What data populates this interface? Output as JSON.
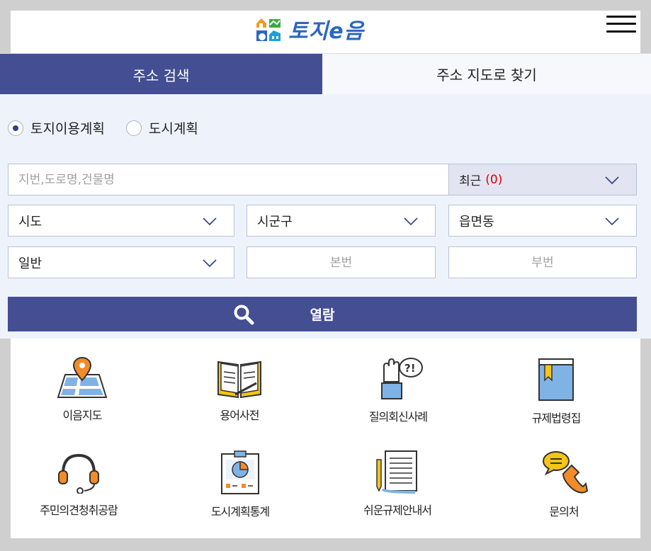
{
  "header": {
    "logo_text": "토지e음",
    "menu_icon": "hamburger-menu-icon"
  },
  "tabs": [
    {
      "label": "주소 검색",
      "active": true
    },
    {
      "label": "주소 지도로 찾기",
      "active": false
    }
  ],
  "plan_type": {
    "options": [
      {
        "label": "토지이용계획",
        "selected": true
      },
      {
        "label": "도시계획",
        "selected": false
      }
    ]
  },
  "search": {
    "placeholder": "지번,도로명,건물명",
    "value": "",
    "recent_label": "최근",
    "recent_count": "(0)"
  },
  "selects": {
    "sido": "시도",
    "sigungu": "시군구",
    "eupmyeondong": "읍면동",
    "land_type": "일반"
  },
  "lot_number": {
    "main_placeholder": "본번",
    "sub_placeholder": "부번"
  },
  "view_button": {
    "label": "열람",
    "icon": "search-icon"
  },
  "quick_menu": [
    {
      "label": "이음지도",
      "icon": "map-pin-icon"
    },
    {
      "label": "용어사전",
      "icon": "dictionary-book-icon"
    },
    {
      "label": "질의회신사례",
      "icon": "hand-question-icon"
    },
    {
      "label": "규제법령집",
      "icon": "law-book-icon"
    },
    {
      "label": "주민의견청취공람",
      "icon": "headset-icon"
    },
    {
      "label": "도시계획통계",
      "icon": "statistics-board-icon"
    },
    {
      "label": "쉬운규제안내서",
      "icon": "document-pencil-icon"
    },
    {
      "label": "문의처",
      "icon": "phone-chat-icon"
    }
  ],
  "colors": {
    "primary": "#434e93",
    "panel_bg": "#eef3fb",
    "recent_count": "#e00000"
  }
}
